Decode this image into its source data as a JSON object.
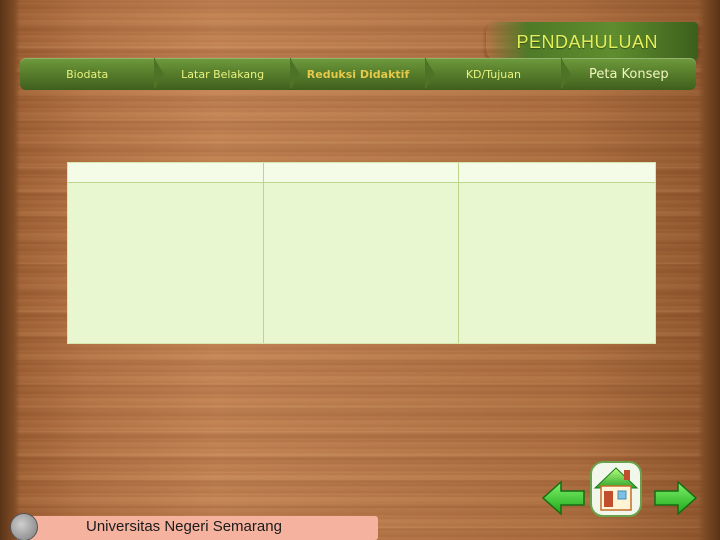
{
  "slide": {
    "title": "PENDAHULUAN",
    "nav": [
      {
        "label": "Biodata",
        "active": false
      },
      {
        "label": "Latar Belakang",
        "active": false
      },
      {
        "label": "Reduksi Didaktif",
        "active": true
      },
      {
        "label": "KD/Tujuan",
        "active": false
      },
      {
        "label": "Peta Konsep",
        "active": false
      }
    ],
    "footer_text": "Universitas  Negeri Semarang",
    "accent": "#5f8d2e",
    "title_color": "#e3ef5a",
    "active_nav_color": "#e6c84a",
    "icons": {
      "prev": "left-arrow-icon",
      "home": "home-icon",
      "next": "right-arrow-icon",
      "logo": "university-logo-icon"
    }
  }
}
